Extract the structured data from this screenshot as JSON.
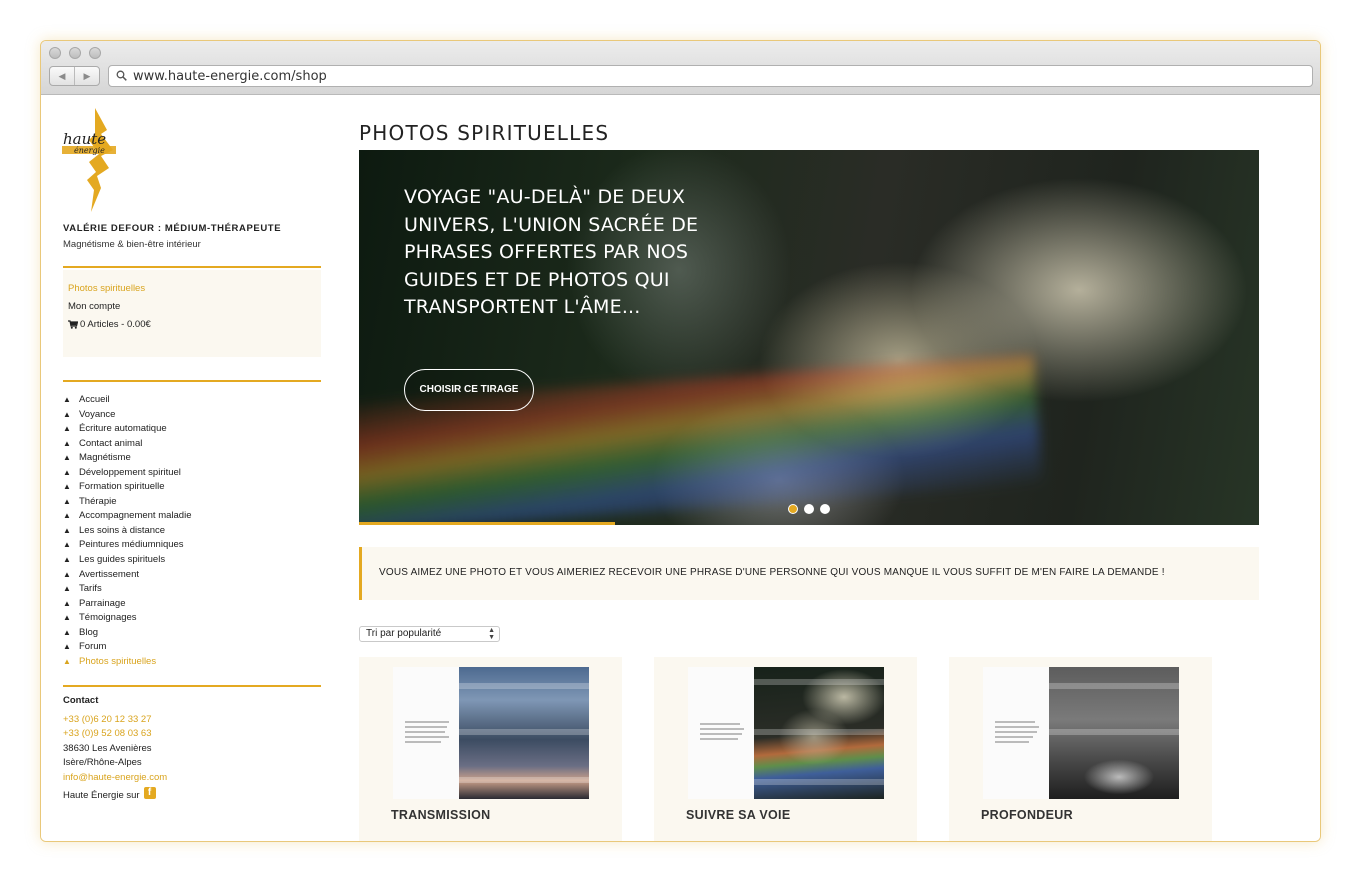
{
  "browser": {
    "url": "www.haute-energie.com/shop",
    "back_icon": "◀",
    "forward_icon": "▶"
  },
  "sidebar": {
    "logo_text_1": "haute",
    "logo_text_2": "énergie",
    "site_title": "VALÉRIE DEFOUR : MÉDIUM-THÉRAPEUTE",
    "site_subtitle": "Magnétisme & bien-être intérieur",
    "account_links": [
      {
        "label": "Photos spirituelles"
      },
      {
        "label": "Mon compte"
      },
      {
        "label": "0 Articles - 0.00€"
      }
    ],
    "menu_bullet": "▲",
    "menu": [
      "Accueil",
      "Voyance",
      "Écriture automatique",
      "Contact animal",
      "Magnétisme",
      "Développement spirituel",
      "Formation spirituelle",
      "Thérapie",
      "Accompagnement maladie",
      "Les soins à distance",
      "Peintures médiumniques",
      "Les guides spirituels",
      "Avertissement",
      "Tarifs",
      "Parrainage",
      "Témoignages",
      "Blog",
      "Forum",
      "Photos spirituelles"
    ],
    "contact_heading": "Contact",
    "contact": {
      "phone1": "+33 (0)6 20 12 33 27",
      "phone2": "+33 (0)9 52 08 03 63",
      "city": "38630 Les Avenières",
      "region": "Isère/Rhône-Alpes",
      "email": "info@haute-energie.com"
    },
    "social_text": "Haute Énergie sur",
    "facebook_letter": "f"
  },
  "main": {
    "title": "PHOTOS SPIRITUELLES",
    "hero": {
      "text": "VOYAGE \"AU-DELÀ\" DE DEUX UNIVERS, L'UNION SACRÉE DE PHRASES OFFERTES PAR NOS GUIDES ET DE PHOTOS QUI TRANSPORTENT L'ÂME...",
      "button": "CHOISIR CE TIRAGE",
      "slide_count": 3,
      "active_slide": 1
    },
    "notice": "VOUS AIMEZ UNE PHOTO ET VOUS AIMERIEZ RECEVOIR UNE PHRASE D'UNE PERSONNE QUI VOUS MANQUE IL VOUS SUFFIT DE M'EN FAIRE LA DEMANDE !",
    "sort_selected": "Tri par popularité",
    "sort_arrows": "▲▼",
    "products": [
      {
        "name": "TRANSMISSION"
      },
      {
        "name": "SUIVRE SA VOIE"
      },
      {
        "name": "PROFONDEUR"
      }
    ]
  },
  "colors": {
    "accent": "#e4a921",
    "accent_text": "#d9a41e",
    "panel_bg": "#fbf8f0"
  }
}
